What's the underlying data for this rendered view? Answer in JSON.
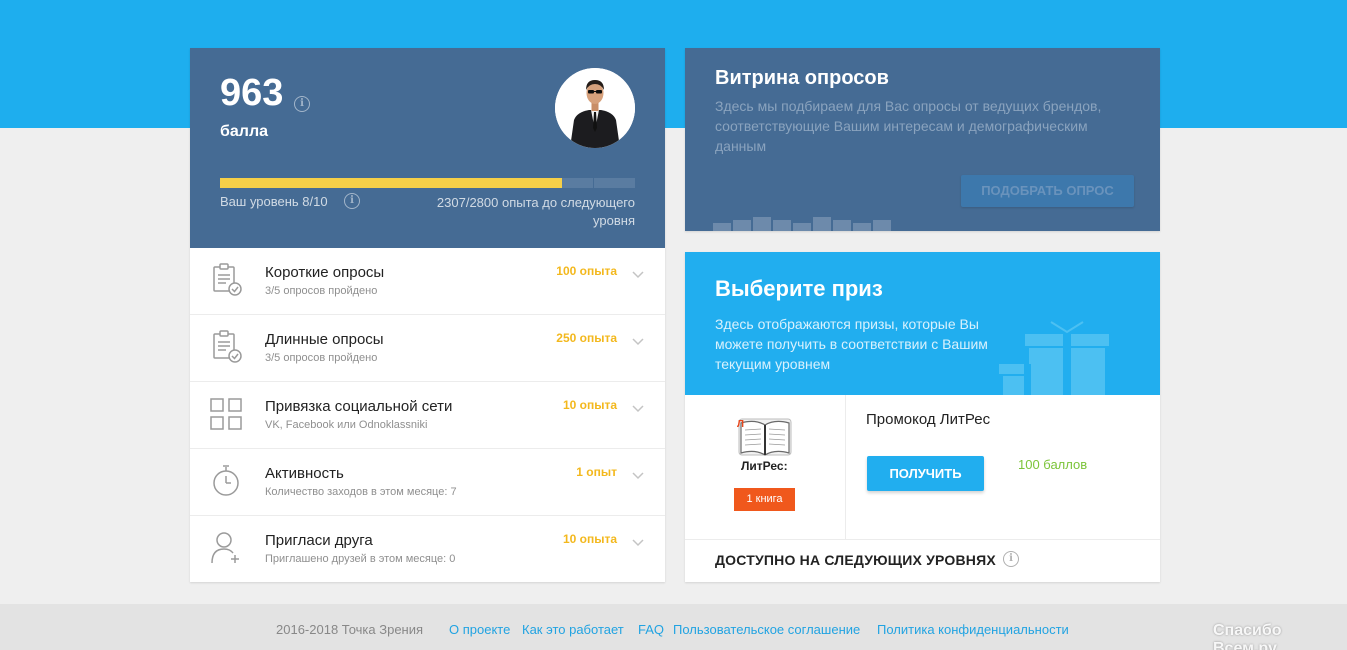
{
  "profile": {
    "points": "963",
    "points_label": "балла",
    "level_text": "Ваш уровень 8/10",
    "exp_text": "2307/2800 опыта до следующего уровня",
    "progress_fraction": 0.824
  },
  "tasks": [
    {
      "title": "Короткие опросы",
      "sub": "3/5 опросов пройдено",
      "xp": "100 опыта",
      "icon": "clipboard-check-icon"
    },
    {
      "title": "Длинные опросы",
      "sub": "3/5 опросов пройдено",
      "xp": "250 опыта",
      "icon": "clipboard-check-icon"
    },
    {
      "title": "Привязка социальной сети",
      "sub": "VK, Facebook или Odnoklassniki",
      "xp": "10 опыта",
      "icon": "grid-icon"
    },
    {
      "title": "Активность",
      "sub": "Количество заходов в этом месяце: 7",
      "xp": "1 опыт",
      "icon": "stopwatch-icon"
    },
    {
      "title": "Пригласи друга",
      "sub": "Приглашено друзей в этом месяце: 0",
      "xp": "10 опыта",
      "icon": "add-user-icon"
    }
  ],
  "showcase": {
    "title": "Витрина опросов",
    "description": "Здесь мы подбираем для Вас опросы от ведущих брендов, соответствующие Вашим интересам и демографическим данным",
    "button": "ПОДОБРАТЬ ОПРОС"
  },
  "prize": {
    "title": "Выберите приз",
    "description": "Здесь отображаются призы, которые Вы можете получить в соответствии с Вашим текущим уровнем",
    "item_name": "Промокод ЛитРес",
    "item_badge": "1 книга",
    "logo_text": "ЛитРес:",
    "get_button": "ПОЛУЧИТЬ",
    "cost": "100 баллов",
    "available_label": "ДОСТУПНО НА СЛЕДУЮЩИХ УРОВНЯХ"
  },
  "footer": {
    "copyright": "2016-2018 Точка Зрения",
    "links": [
      "О проекте",
      "Как это работает",
      "FAQ",
      "Пользовательское соглашение",
      "Политика конфиденциальности"
    ]
  },
  "watermark": "Спасибо Всем.ру",
  "colors": {
    "topband": "#1eaeee",
    "profile": "#456b94",
    "accent": "#21aeef",
    "xp": "#f3b81d",
    "progress": "#f5cf48",
    "cost": "#7cc43a"
  }
}
